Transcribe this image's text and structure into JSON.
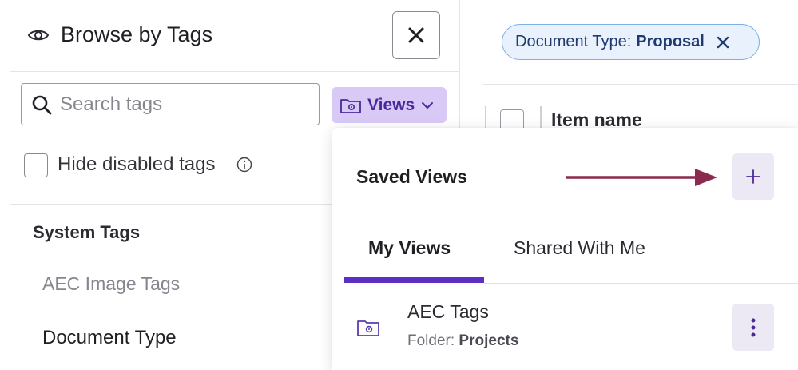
{
  "panel": {
    "title": "Browse by Tags",
    "search": {
      "placeholder": "Search tags",
      "value": ""
    },
    "views_button": {
      "label": "Views"
    },
    "hide_disabled": {
      "label": "Hide disabled tags",
      "checked": false
    },
    "section": {
      "title": "System Tags",
      "items": [
        {
          "label": "AEC Image Tags",
          "disabled": true
        },
        {
          "label": "Document Type",
          "disabled": false
        }
      ]
    }
  },
  "main": {
    "filter_chip": {
      "key": "Document Type:",
      "value": "Proposal"
    },
    "table": {
      "column_header": "Item name"
    }
  },
  "views_dropdown": {
    "title": "Saved Views",
    "tabs": [
      {
        "label": "My Views",
        "active": true
      },
      {
        "label": "Shared With Me",
        "active": false
      }
    ],
    "views": [
      {
        "name": "AEC Tags",
        "folder_label": "Folder:",
        "folder_value": "Projects"
      }
    ]
  },
  "colors": {
    "accent": "#5b2ec4",
    "views_button_bg": "#d9c9f7",
    "chip_bg": "#e9f2fc",
    "chip_border": "#7eb0e6",
    "annotation_arrow": "#8b2a4e"
  },
  "icons": {
    "header": "eye-icon",
    "close": "close-icon",
    "search": "search-icon",
    "views": "folder-gear-icon",
    "chevron": "chevron-down-icon",
    "info": "info-icon",
    "add": "plus-icon",
    "more": "kebab-icon"
  }
}
